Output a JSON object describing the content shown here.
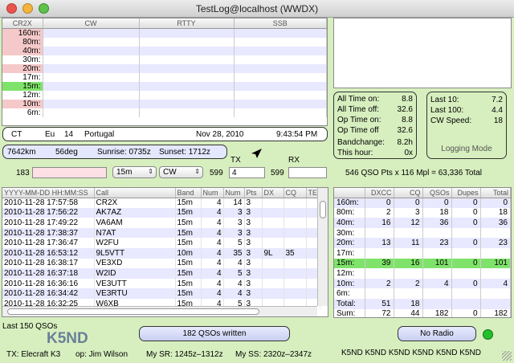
{
  "window": {
    "title": "TestLog@localhost (WWDX)"
  },
  "multipliers": {
    "columns": [
      "CR2X",
      "CW",
      "RTTY",
      "SSB"
    ],
    "rows": [
      {
        "band": "160m:",
        "color": "#f5c9c9"
      },
      {
        "band": "80m:",
        "color": "#f5c9c9"
      },
      {
        "band": "40m:",
        "color": "#f5c9c9"
      },
      {
        "band": "30m:",
        "color": ""
      },
      {
        "band": "20m:",
        "color": "#f5c9c9"
      },
      {
        "band": "17m:",
        "color": ""
      },
      {
        "band": "15m:",
        "color": "#7fe36b"
      },
      {
        "band": "12m:",
        "color": ""
      },
      {
        "band": "10m:",
        "color": "#f5c9c9"
      },
      {
        "band": "6m:",
        "color": ""
      }
    ]
  },
  "country": {
    "prefix": "CT",
    "continent": "Eu",
    "zone": "14",
    "name": "Portugal",
    "date": "Nov 28, 2010",
    "time": "9:43:54 PM"
  },
  "distance": {
    "distance": "7642km",
    "heading": "56deg",
    "sunrise": "Sunrise: 0735z",
    "sunset": "Sunset: 1712z"
  },
  "entry": {
    "serial": "183",
    "band": "15m",
    "mode": "CW",
    "tx_label": "TX",
    "rx_label": "RX",
    "tx_rst": "599",
    "tx_num": "4",
    "rx_rst": "599"
  },
  "score": {
    "text": "546 QSO Pts x 116 Mpl = 63,336 Total"
  },
  "timers": [
    {
      "label": "All Time on:",
      "value": "8.8"
    },
    {
      "label": "All Time off:",
      "value": "32.6"
    },
    {
      "label": "Op Time on:",
      "value": "8.8"
    },
    {
      "label": "Op Time off",
      "value": "32.6"
    },
    {
      "label": "Bandchange:",
      "value": "8.2h"
    },
    {
      "label": "This hour:",
      "value": "0x"
    }
  ],
  "rates": [
    {
      "label": "Last 10:",
      "value": "7.2"
    },
    {
      "label": "Last 100:",
      "value": "4.4"
    },
    {
      "label": "CW Speed:",
      "value": "18"
    }
  ],
  "logging_mode": "Logging Mode",
  "log": {
    "columns": [
      "YYYY-MM-DD HH:MM:SS",
      "Call",
      "Band",
      "Num",
      "Num",
      "Pts",
      "DX",
      "CQ",
      "TE"
    ],
    "rows": [
      {
        "time": "2010-11-28 17:57:58",
        "call": "CR2X",
        "band": "15m",
        "num1": "4",
        "num2": "14",
        "pts": "3",
        "dx": "",
        "cq": ""
      },
      {
        "time": "2010-11-28 17:56:22",
        "call": "AK7AZ",
        "band": "15m",
        "num1": "4",
        "num2": "3",
        "pts": "3",
        "dx": "",
        "cq": ""
      },
      {
        "time": "2010-11-28 17:49:22",
        "call": "VA6AM",
        "band": "15m",
        "num1": "4",
        "num2": "3",
        "pts": "3",
        "dx": "",
        "cq": ""
      },
      {
        "time": "2010-11-28 17:38:37",
        "call": "N7AT",
        "band": "15m",
        "num1": "4",
        "num2": "3",
        "pts": "3",
        "dx": "",
        "cq": ""
      },
      {
        "time": "2010-11-28 17:36:47",
        "call": "W2FU",
        "band": "15m",
        "num1": "4",
        "num2": "5",
        "pts": "3",
        "dx": "",
        "cq": ""
      },
      {
        "time": "2010-11-28 16:53:12",
        "call": "9L5VTT",
        "band": "10m",
        "num1": "4",
        "num2": "35",
        "pts": "3",
        "dx": "9L",
        "cq": "35"
      },
      {
        "time": "2010-11-28 16:38:17",
        "call": "VE3XD",
        "band": "15m",
        "num1": "4",
        "num2": "4",
        "pts": "3",
        "dx": "",
        "cq": ""
      },
      {
        "time": "2010-11-28 16:37:18",
        "call": "W2ID",
        "band": "15m",
        "num1": "4",
        "num2": "5",
        "pts": "3",
        "dx": "",
        "cq": ""
      },
      {
        "time": "2010-11-28 16:36:16",
        "call": "VE3UTT",
        "band": "15m",
        "num1": "4",
        "num2": "4",
        "pts": "3",
        "dx": "",
        "cq": ""
      },
      {
        "time": "2010-11-28 16:34:42",
        "call": "VE3RTU",
        "band": "15m",
        "num1": "4",
        "num2": "4",
        "pts": "3",
        "dx": "",
        "cq": ""
      },
      {
        "time": "2010-11-28 16:32:25",
        "call": "W6XB",
        "band": "15m",
        "num1": "4",
        "num2": "5",
        "pts": "3",
        "dx": "",
        "cq": ""
      }
    ]
  },
  "summary": {
    "columns": [
      "",
      "DXCC",
      "CQ",
      "QSOs",
      "Dupes",
      "Total"
    ],
    "rows": [
      {
        "band": "160m:",
        "dxcc": "0",
        "cq": "0",
        "qsos": "0",
        "dupes": "0",
        "total": "0",
        "hl": false
      },
      {
        "band": "80m:",
        "dxcc": "2",
        "cq": "3",
        "qsos": "18",
        "dupes": "0",
        "total": "18",
        "hl": false
      },
      {
        "band": "40m:",
        "dxcc": "16",
        "cq": "12",
        "qsos": "36",
        "dupes": "0",
        "total": "36",
        "hl": false
      },
      {
        "band": "30m:",
        "dxcc": "",
        "cq": "",
        "qsos": "",
        "dupes": "",
        "total": "",
        "hl": false
      },
      {
        "band": "20m:",
        "dxcc": "13",
        "cq": "11",
        "qsos": "23",
        "dupes": "0",
        "total": "23",
        "hl": false
      },
      {
        "band": "17m:",
        "dxcc": "",
        "cq": "",
        "qsos": "",
        "dupes": "",
        "total": "",
        "hl": false
      },
      {
        "band": "15m:",
        "dxcc": "39",
        "cq": "16",
        "qsos": "101",
        "dupes": "0",
        "total": "101",
        "hl": true
      },
      {
        "band": "12m:",
        "dxcc": "",
        "cq": "",
        "qsos": "",
        "dupes": "",
        "total": "",
        "hl": false
      },
      {
        "band": "10m:",
        "dxcc": "2",
        "cq": "2",
        "qsos": "4",
        "dupes": "0",
        "total": "4",
        "hl": false
      },
      {
        "band": "6m:",
        "dxcc": "",
        "cq": "",
        "qsos": "",
        "dupes": "",
        "total": "",
        "hl": false
      },
      {
        "band": "Total:",
        "dxcc": "51",
        "cq": "18",
        "qsos": "",
        "dupes": "",
        "total": "",
        "hl": false
      },
      {
        "band": "Sum:",
        "dxcc": "72",
        "cq": "44",
        "qsos": "182",
        "dupes": "0",
        "total": "182",
        "hl": false
      }
    ]
  },
  "footer": {
    "last_qsos": "Last 150 QSOs",
    "callsign": "K5ND",
    "qsos_written": "182 QSOs written",
    "radio": "No Radio",
    "tx": "TX: Elecraft K3",
    "op": "op: Jim Wilson",
    "sr": "My SR: 1245z–1312z",
    "ss": "My SS: 2320z–2347z",
    "ticker": "K5ND K5ND K5ND K5ND K5ND K5ND"
  },
  "colors": {
    "background": "#d7efbf",
    "highlight": "#7fe36b",
    "radio_led": "#22c02a"
  }
}
